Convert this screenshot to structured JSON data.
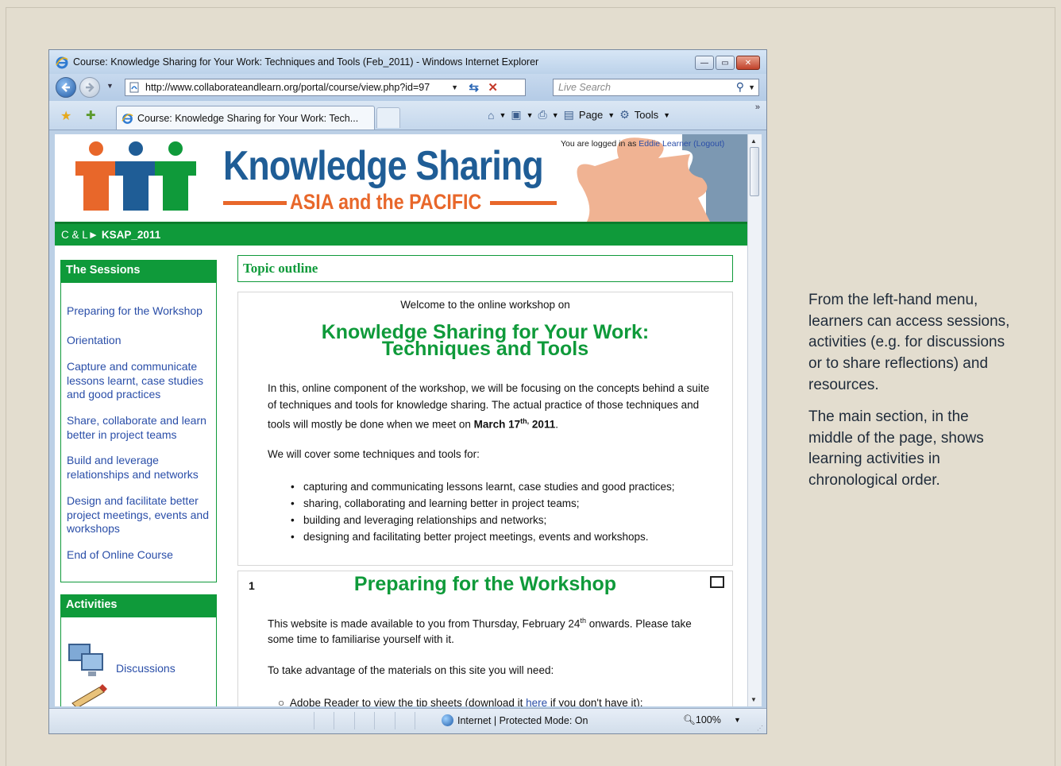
{
  "browser": {
    "window_title": "Course: Knowledge Sharing for Your Work: Techniques and Tools (Feb_2011) - Windows Internet Explorer",
    "address": "http://www.collaborateandlearn.org/portal/course/view.php?id=97",
    "search_placeholder": "Live Search",
    "tab_title": "Course: Knowledge Sharing for Your Work: Tech...",
    "cmd": {
      "page": "Page",
      "tools": "Tools"
    },
    "status_zone": "Internet | Protected Mode: On",
    "zoom": "100%"
  },
  "page": {
    "login_prefix": "You are logged in as",
    "login_user": "Eddie Learner",
    "logout": "(Logout)",
    "brand_title": "Knowledge Sharing",
    "brand_sub": "ASIA and the PACIFIC",
    "crumb_root": "C & L",
    "crumb_arrow": "►",
    "crumb_current": "KSAP_2011",
    "sessions_heading": "The Sessions",
    "sessions": [
      "Preparing for the Workshop",
      "Orientation",
      "Capture and communicate lessons learnt, case studies and good practices",
      "Share, collaborate and learn better in project teams",
      "Build and leverage relationships and networks",
      "Design and facilitate better project meetings, events and workshops",
      "End of Online Course"
    ],
    "activities_heading": "Activities",
    "activity_discussions": "Discussions",
    "topic_outline": "Topic outline",
    "welcome": "Welcome to the online workshop on",
    "course_title_1": "Knowledge Sharing for Your Work:",
    "course_title_2": "Techniques and Tools",
    "intro_1": "In this, online component of the workshop, we will be focusing on the concepts behind a suite of techniques and tools for knowledge sharing. The actual practice of those techniques and tools will mostly be done when we meet on ",
    "intro_date": "March 17",
    "intro_date_sup": "th,",
    "intro_year": " 2011",
    "intro_end": ".",
    "cover": "We will cover some techniques and tools for:",
    "bullets": [
      "capturing and communicating lessons learnt, case studies and good practices;",
      "sharing, collaborating and learning better in project teams;",
      "building and leveraging relationships and networks;",
      "designing and facilitating better project meetings, events and workshops."
    ],
    "section1_num": "1",
    "section1_title": "Preparing for the Workshop",
    "section1_p1a": "This website is made available to you from Thursday, February 24",
    "section1_p1sup": "th",
    "section1_p1b": " onwards.  Please take some time to familiarise yourself with it.",
    "section1_p2": "To take advantage of the materials on this site you will need:",
    "section1_sub_a": "Adobe Reader to view the tip sheets (download it ",
    "section1_sub_link": "here",
    "section1_sub_b": " if you don't have it);"
  },
  "caption": {
    "p1": "From the left-hand menu, learners can access sessions, activities (e.g. for discussions or to share reflections) and resources.",
    "p2": "The main section, in the middle of the page, shows learning activities in chronological order."
  },
  "colors": {
    "brand_green": "#0f9a3a",
    "brand_blue": "#1f5d96",
    "brand_orange": "#e8672a",
    "link_blue": "#2a4ea8",
    "background": "#e3ddcf"
  }
}
